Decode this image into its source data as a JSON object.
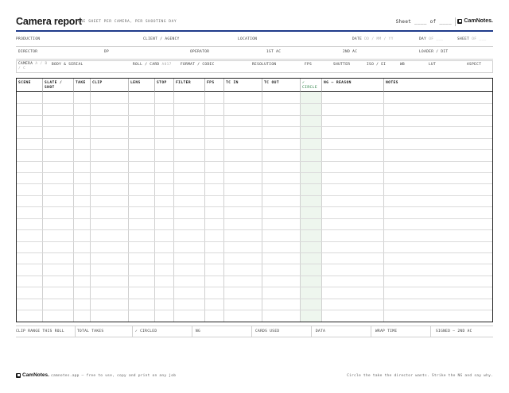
{
  "header": {
    "title": "Camera report",
    "subtitle": "ONE SHEET PER CAMERA, PER SHOOTING DAY",
    "sheet_count": "Sheet ____ of ____",
    "brand": "CamNotes."
  },
  "meta": {
    "row1": {
      "production": "PRODUCTION",
      "client": "CLIENT / AGENCY",
      "location": "LOCATION",
      "date_label": "DATE",
      "date_hint": "DD / MM / YY",
      "day_label": "DAY",
      "day_hint": "OF ___",
      "sheet_label": "SHEET",
      "sheet_hint": "OF ___"
    },
    "row2": {
      "director": "DIRECTOR",
      "dp": "DP",
      "operator": "OPERATOR",
      "first_ac": "1ST AC",
      "second_ac": "2ND AC",
      "loader": "LOADER / DIT"
    },
    "row3": {
      "camera_label": "CAMERA",
      "camera_hint_a": "A / B",
      "camera_hint_b": "/ C",
      "body": "BODY & SERIAL",
      "roll_label": "ROLL / CARD",
      "roll_hint": "A017",
      "format": "FORMAT / CODEC",
      "resolution": "RESOLUTION",
      "fps": "FPS",
      "shutter": "SHUTTER",
      "iso": "ISO / EI",
      "wb": "WB",
      "lut": "LUT",
      "aspect": "ASPECT"
    }
  },
  "table": {
    "columns": [
      {
        "key": "scene",
        "label": "SCENE"
      },
      {
        "key": "slate",
        "label": "SLATE / SHOT"
      },
      {
        "key": "take",
        "label": "TAKE"
      },
      {
        "key": "clip",
        "label": "CLIP"
      },
      {
        "key": "lens",
        "label": "LENS"
      },
      {
        "key": "stop",
        "label": "STOP"
      },
      {
        "key": "filter",
        "label": "FILTER"
      },
      {
        "key": "fps",
        "label": "FPS"
      },
      {
        "key": "tc_in",
        "label": "TC IN"
      },
      {
        "key": "tc_out",
        "label": "TC OUT"
      },
      {
        "key": "circle",
        "label": "✓ CIRCLE"
      },
      {
        "key": "ng",
        "label": "NG — REASON"
      },
      {
        "key": "notes",
        "label": "NOTES"
      }
    ]
  },
  "summary": {
    "clip_range": "CLIP RANGE THIS ROLL",
    "total_takes": "TOTAL TAKES",
    "circled": "✓ CIRCLED",
    "ng": "NG",
    "cards_used": "CARDS USED",
    "data": "DATA",
    "wrap_time": "WRAP TIME",
    "signed": "SIGNED — 2ND AC"
  },
  "footer": {
    "brand": "CamNotes.",
    "note": "camnotes.app — free to use, copy and print on any job",
    "tip": "Circle the take the director wants. Strike the NG and say why."
  },
  "colors": {
    "accent_blue": "#1e3a8a",
    "circle_green": "#1f7a3a",
    "circle_bg": "#eef6ee"
  }
}
